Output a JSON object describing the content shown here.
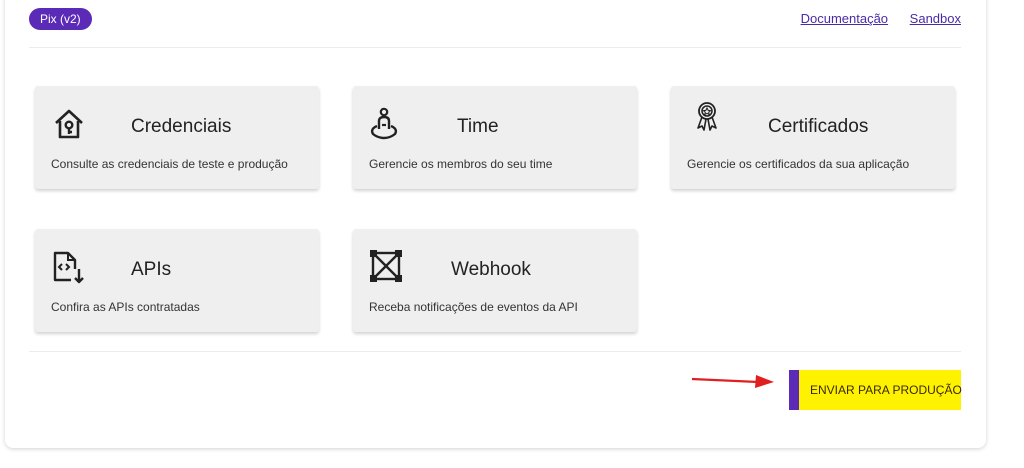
{
  "header": {
    "badge": "Pix (v2)",
    "links": {
      "documentation": "Documentação",
      "sandbox": "Sandbox"
    }
  },
  "cards": [
    {
      "icon": "house-key-icon",
      "title": "Credenciais",
      "description": "Consulte as credenciais de teste e produção"
    },
    {
      "icon": "team-person-icon",
      "title": "Time",
      "description": "Gerencie os membros do seu time"
    },
    {
      "icon": "award-ribbon-icon",
      "title": "Certificados",
      "description": "Gerencie os certificados da sua aplicação"
    },
    {
      "icon": "code-file-download-icon",
      "title": "APIs",
      "description": "Confira as APIs contratadas"
    },
    {
      "icon": "webhook-network-icon",
      "title": "Webhook",
      "description": "Receba notificações de eventos da API"
    }
  ],
  "footer": {
    "send_button": "ENVIAR PARA PRODUÇÃO"
  },
  "colors": {
    "brand_purple": "#5b2bb7",
    "cta_yellow": "#fff200",
    "annotation_arrow": "#e02020"
  }
}
